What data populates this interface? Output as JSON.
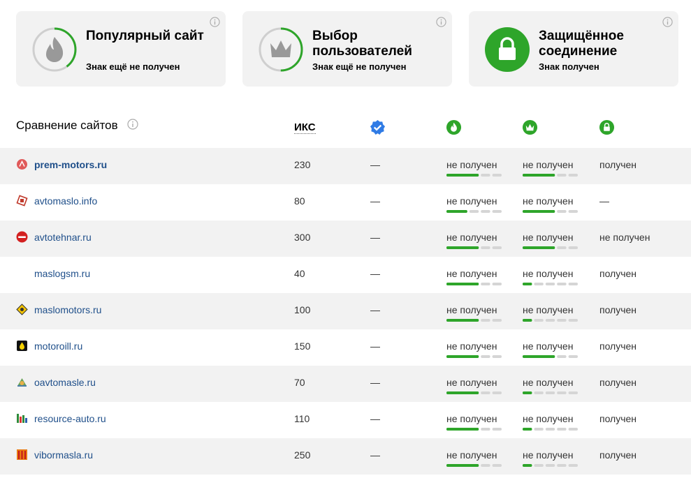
{
  "badges": [
    {
      "title": "Популярный сайт",
      "status": "Знак ещё не получен",
      "icon": "flame-icon",
      "progress": 0.4,
      "active": false
    },
    {
      "title": "Выбор пользователей",
      "status": "Знак ещё не получен",
      "icon": "crown-icon",
      "progress": 0.5,
      "active": false
    },
    {
      "title": "Защищённое соединение",
      "status": "Знак получен",
      "icon": "lock-icon",
      "progress": 1,
      "active": true
    }
  ],
  "comparison": {
    "title": "Сравнение сайтов",
    "col_iks": "ИКС",
    "rows": [
      {
        "site": "prem-motors.ru",
        "bold": true,
        "iks": "230",
        "verified": "—",
        "popular": "не получен",
        "popular_progress": 0.6,
        "choice": "не получен",
        "choice_progress": 0.6,
        "secure": "получен"
      },
      {
        "site": "avtomaslo.info",
        "bold": false,
        "iks": "80",
        "verified": "—",
        "popular": "не получен",
        "popular_progress": 0.4,
        "choice": "не получен",
        "choice_progress": 0.6,
        "secure": "—"
      },
      {
        "site": "avtotehnar.ru",
        "bold": false,
        "iks": "300",
        "verified": "—",
        "popular": "не получен",
        "popular_progress": 0.6,
        "choice": "не получен",
        "choice_progress": 0.6,
        "secure": "не получен"
      },
      {
        "site": "maslogsm.ru",
        "bold": false,
        "iks": "40",
        "verified": "—",
        "popular": "не получен",
        "popular_progress": 0.6,
        "choice": "не получен",
        "choice_progress": 0.2,
        "secure": "получен"
      },
      {
        "site": "maslomotors.ru",
        "bold": false,
        "iks": "100",
        "verified": "—",
        "popular": "не получен",
        "popular_progress": 0.6,
        "choice": "не получен",
        "choice_progress": 0.2,
        "secure": "получен"
      },
      {
        "site": "motoroill.ru",
        "bold": false,
        "iks": "150",
        "verified": "—",
        "popular": "не получен",
        "popular_progress": 0.6,
        "choice": "не получен",
        "choice_progress": 0.6,
        "secure": "получен"
      },
      {
        "site": "oavtomasle.ru",
        "bold": false,
        "iks": "70",
        "verified": "—",
        "popular": "не получен",
        "popular_progress": 0.6,
        "choice": "не получен",
        "choice_progress": 0.2,
        "secure": "получен"
      },
      {
        "site": "resource-auto.ru",
        "bold": false,
        "iks": "110",
        "verified": "—",
        "popular": "не получен",
        "popular_progress": 0.6,
        "choice": "не получен",
        "choice_progress": 0.2,
        "secure": "получен"
      },
      {
        "site": "vibormasla.ru",
        "bold": false,
        "iks": "250",
        "verified": "—",
        "popular": "не получен",
        "popular_progress": 0.6,
        "choice": "не получен",
        "choice_progress": 0.2,
        "secure": "получен"
      }
    ]
  },
  "colors": {
    "green": "#2ea52a",
    "gray": "#d5d5d5",
    "icon_gray": "#999999",
    "link": "#1f4f8a",
    "verified_blue": "#2f7be5"
  }
}
